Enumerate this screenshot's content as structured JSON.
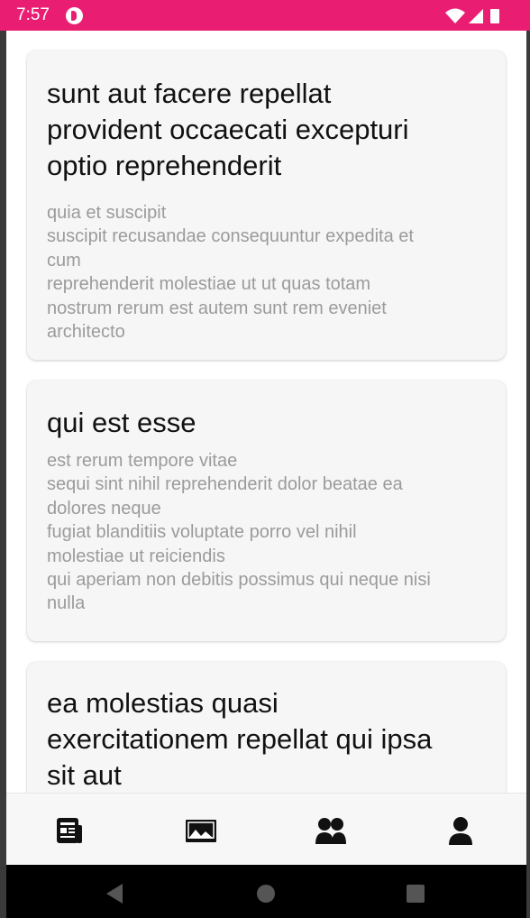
{
  "status_bar": {
    "time": "7:57",
    "app_icon": "notification-app-icon",
    "icons": [
      "wifi-icon",
      "cell-signal-icon",
      "battery-icon"
    ],
    "background": "#e91e72"
  },
  "posts": [
    {
      "title": "sunt aut facere repellat\nprovident occaecati excepturi\noptio reprehenderit",
      "body": "quia et suscipit\nsuscipit recusandae consequuntur expedita et\ncum\nreprehenderit molestiae ut ut quas totam\nnostrum rerum est autem sunt rem eveniet\narchitecto"
    },
    {
      "title": "qui est esse",
      "body": "est rerum tempore vitae\nsequi sint nihil reprehenderit dolor beatae ea\ndolores neque\nfugiat blanditiis voluptate porro vel nihil\nmolestiae ut reiciendis\nqui aperiam non debitis possimus qui neque nisi\nnulla"
    },
    {
      "title": "ea molestias quasi\nexercitationem repellat qui ipsa\nsit aut",
      "body": ""
    }
  ],
  "bottom_nav": {
    "items": [
      {
        "icon": "article-icon"
      },
      {
        "icon": "image-icon"
      },
      {
        "icon": "people-icon"
      },
      {
        "icon": "person-icon"
      }
    ]
  },
  "system_nav": [
    "back-icon",
    "home-icon",
    "recents-icon"
  ]
}
